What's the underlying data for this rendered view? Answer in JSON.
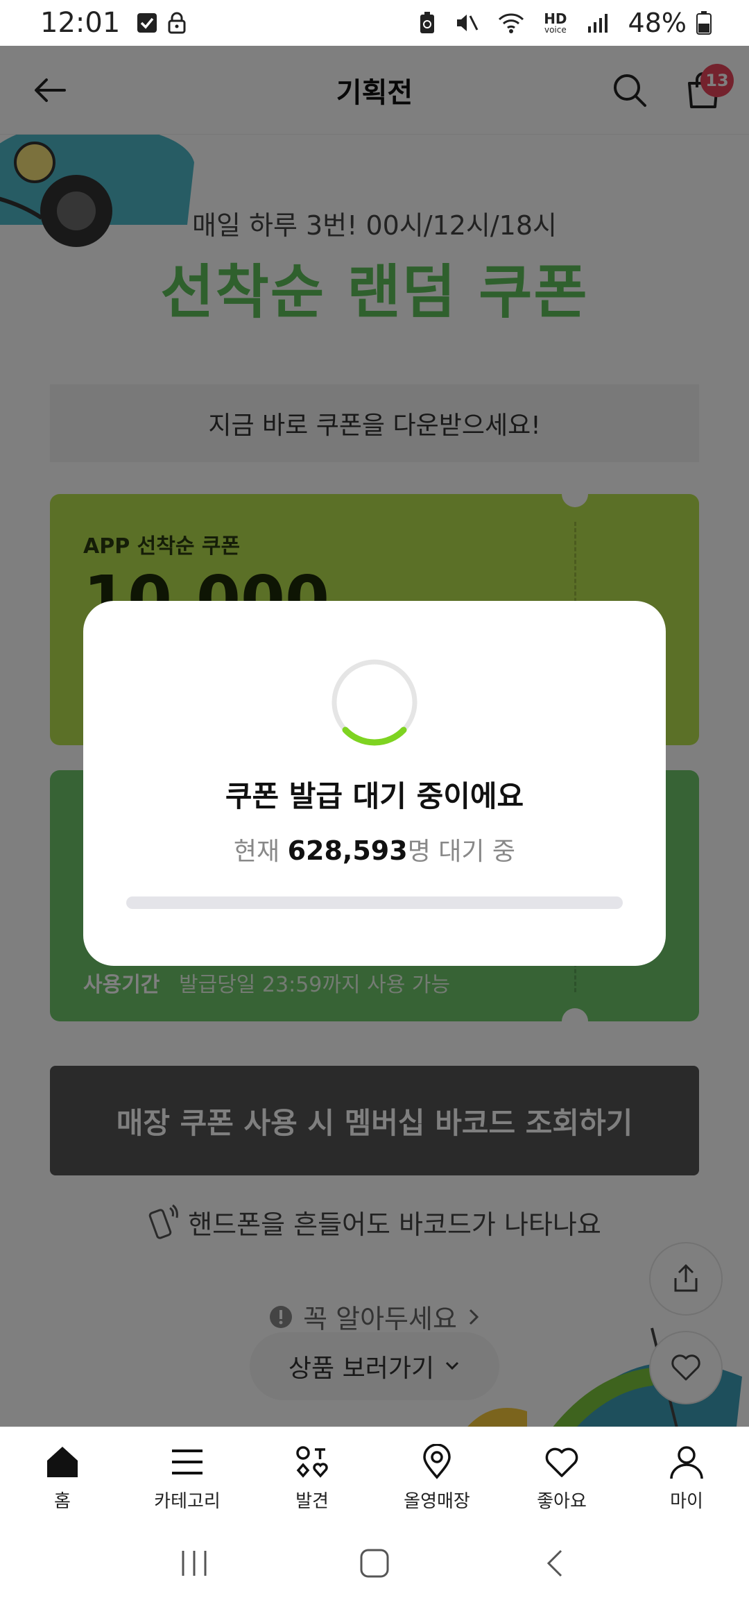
{
  "status_bar": {
    "time": "12:01",
    "battery": "48%",
    "icons": [
      "checkbox-notification-icon",
      "lock-icon",
      "battery-saver-icon",
      "mute-icon",
      "wifi-icon",
      "hd-voice-icon",
      "signal-icon",
      "battery-icon"
    ],
    "hd_label": "HD",
    "voice_label": "voice"
  },
  "header": {
    "title": "기획전",
    "cart_count": "13"
  },
  "promo": {
    "subtitle": "매일 하루 3번! 00시/12시/18시",
    "title": "선착순 랜덤 쿠폰",
    "download_text": "지금 바로 쿠폰을 다운받으세요!"
  },
  "coupons": [
    {
      "label": "APP 선착순 쿠폰",
      "amount": "10,000",
      "color": "#b7e04e"
    },
    {
      "use_label": "사용기간",
      "use_value": "발급당일 23:59까지 사용 가능",
      "color": "#6ec76b"
    }
  ],
  "barcode_button": "매장 쿠폰 사용 시 멤버십 바코드 조회하기",
  "shake_note": "핸드폰을 흔들어도 바코드가 나타나요",
  "notice_link": "꼭 알아두세요",
  "view_products": "상품 보러가기",
  "modal": {
    "title": "쿠폰 발급 대기 중이에요",
    "count_prefix": "현재 ",
    "count_number": "628,593",
    "count_suffix": "명 대기 중",
    "progress": 0,
    "spinner_color": "#7ed321"
  },
  "bottom_nav": [
    {
      "label": "홈",
      "icon": "home-icon",
      "active": true
    },
    {
      "label": "카테고리",
      "icon": "menu-icon",
      "active": false
    },
    {
      "label": "발견",
      "icon": "discover-icon",
      "active": false
    },
    {
      "label": "올영매장",
      "icon": "location-pin-icon",
      "active": false
    },
    {
      "label": "좋아요",
      "icon": "heart-icon",
      "active": false
    },
    {
      "label": "마이",
      "icon": "person-icon",
      "active": false
    }
  ],
  "colors": {
    "accent_green": "#5fc05a",
    "badge_red": "#e8455a"
  }
}
